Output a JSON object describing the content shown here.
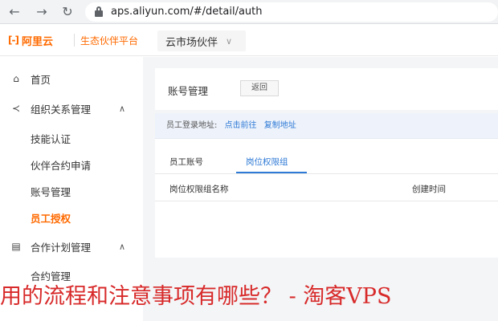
{
  "browser": {
    "url": "aps.aliyun.com/#/detail/auth",
    "back_icon": "back-arrow-icon",
    "forward_icon": "forward-arrow-icon",
    "reload_icon": "reload-icon"
  },
  "header": {
    "logo_text": "阿里云",
    "logo_mark": "[-]",
    "platform": "生态伙伴平台",
    "market_select": "云市场伙伴",
    "brand_color": "#ff6a00"
  },
  "sidebar": {
    "items": [
      {
        "label": "首页",
        "icon": "home-icon"
      },
      {
        "label": "组织关系管理",
        "icon": "share-icon",
        "expanded": true
      },
      {
        "label": "技能认证"
      },
      {
        "label": "伙伴合约申请"
      },
      {
        "label": "账号管理"
      },
      {
        "label": "员工授权",
        "active": true
      },
      {
        "label": "合作计划管理",
        "icon": "calendar-icon",
        "expanded": true
      },
      {
        "label": "合约管理"
      }
    ],
    "active_color": "#ff6a00"
  },
  "main": {
    "title": "账号管理",
    "back_label": "返回",
    "login_label": "员工登录地址:",
    "login_link": "点击前往",
    "copy_link": "复制地址",
    "tabs": [
      {
        "label": "员工账号"
      },
      {
        "label": "岗位权限组",
        "active": true
      }
    ],
    "table_headers": [
      "岗位权限组名称",
      "创建时间"
    ],
    "link_color": "#2f7ad6"
  },
  "overlay_text": "用的流程和注意事项有哪些？ - 淘客VPS"
}
